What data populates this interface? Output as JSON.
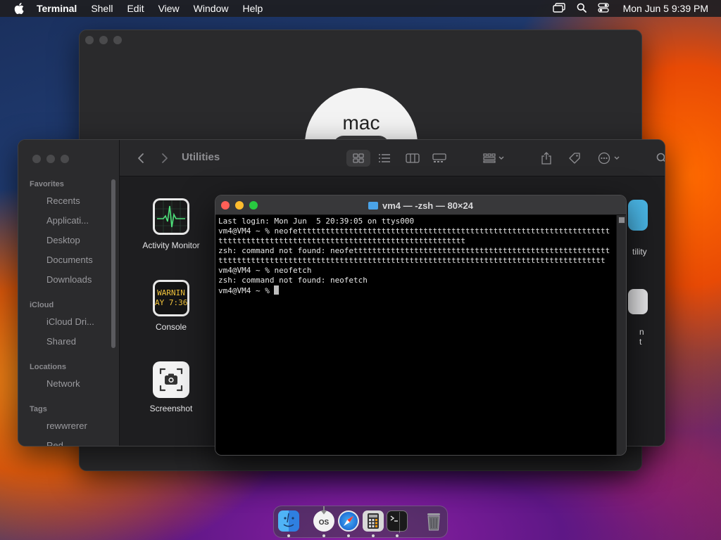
{
  "menubar": {
    "app_name": "Terminal",
    "items": [
      "Shell",
      "Edit",
      "View",
      "Window",
      "Help"
    ],
    "clock": "Mon Jun 5  9:39 PM"
  },
  "about_window": {
    "logo_text": "mac"
  },
  "finder": {
    "title": "Utilities",
    "sidebar": {
      "favorites_label": "Favorites",
      "favorites": [
        "Recents",
        "Applicati...",
        "Desktop",
        "Documents",
        "Downloads"
      ],
      "icloud_label": "iCloud",
      "icloud": [
        "iCloud Dri...",
        "Shared"
      ],
      "locations_label": "Locations",
      "locations": [
        "Network"
      ],
      "tags_label": "Tags",
      "tags": [
        "rewwrerer",
        "Red"
      ]
    },
    "apps": [
      {
        "label": "Activity Monitor",
        "icon": "activity-monitor-icon"
      },
      {
        "label": "Console",
        "icon": "console-icon",
        "icon_text_1": "WARNIN",
        "icon_text_2": "AY 7:36"
      },
      {
        "label": "Screenshot",
        "icon": "screenshot-icon"
      }
    ],
    "partial_labels": [
      "tility",
      "n",
      "t"
    ]
  },
  "terminal": {
    "title": "vm4 — -zsh — 80×24",
    "lines": [
      "Last login: Mon Jun  5 20:39:05 on ttys000",
      "vm4@VM4 ~ % neofettttttttttttttttttttttttttttttttttttttttttttttttttttttttttttttttttt",
      "ttttttttttttttttttttttttttttttttttttttttttttttttttttt",
      "zsh: command not found: neofettttttttttttttttttttttttttttttttttttttttttttttttttttttt",
      "ttttttttttttttttttttttttttttttttttttttttttttttttttttttttttttttttttttttttttttttttttt",
      "vm4@VM4 ~ % neofetch",
      "zsh: command not found: neofetch",
      "vm4@VM4 ~ % "
    ]
  },
  "dock": {
    "items": [
      "finder-icon",
      "macos-installer-icon",
      "safari-icon",
      "calculator-icon",
      "terminal-icon",
      "trash-icon"
    ],
    "installer_text": "OS"
  },
  "colors": {
    "close": "#ff5f57",
    "minimize": "#febc2e",
    "zoom": "#28c840"
  }
}
